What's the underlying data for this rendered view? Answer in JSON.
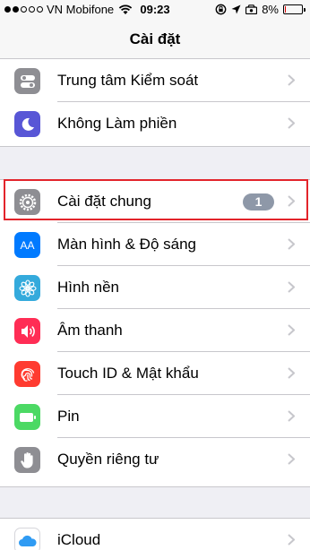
{
  "status_bar": {
    "carrier": "VN Mobifone",
    "time": "09:23",
    "battery_percent": "8%",
    "battery_level": 0.08
  },
  "nav": {
    "title": "Cài đặt"
  },
  "group1": [
    {
      "label": "Trung tâm Kiểm soát",
      "icon": "control-center-icon",
      "color": "#8e8e93"
    },
    {
      "label": "Không Làm phiền",
      "icon": "moon-icon",
      "color": "#5856d6"
    }
  ],
  "group2": [
    {
      "label": "Cài đặt chung",
      "icon": "gear-icon",
      "color": "#8e8e93",
      "badge": "1"
    },
    {
      "label": "Màn hình & Độ sáng",
      "icon": "text-size-icon",
      "color": "#007aff"
    },
    {
      "label": "Hình nền",
      "icon": "flower-icon",
      "color": "#34aadc"
    },
    {
      "label": "Âm thanh",
      "icon": "speaker-icon",
      "color": "#ff2d55"
    },
    {
      "label": "Touch ID & Mật khẩu",
      "icon": "fingerprint-icon",
      "color": "#ff3b30"
    },
    {
      "label": "Pin",
      "icon": "battery-icon",
      "color": "#4cd964"
    },
    {
      "label": "Quyền riêng tư",
      "icon": "hand-icon",
      "color": "#8e8e93"
    }
  ],
  "group3": [
    {
      "label": "iCloud",
      "icon": "cloud-icon",
      "color": "#ffffff"
    }
  ],
  "icon_glyphs": {
    "text_size": "AA"
  },
  "highlight_color": "#e3242b"
}
